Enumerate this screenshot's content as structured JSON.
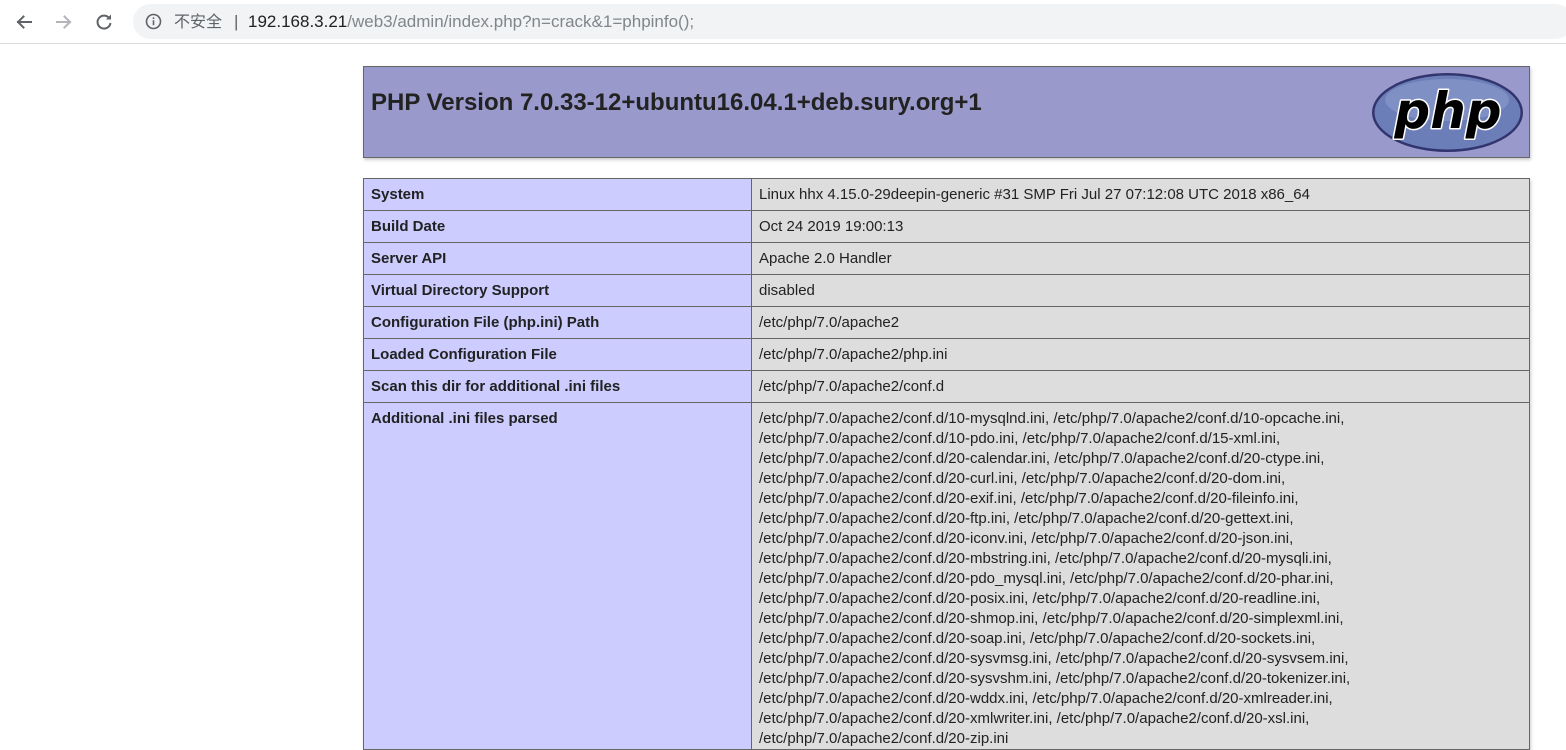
{
  "browser": {
    "security_label": "不安全",
    "separator": "|",
    "url_host": "192.168.3.21",
    "url_path": "/web3/admin/index.php?n=crack&1=phpinfo();",
    "icons": {
      "back": "arrow-left-icon",
      "forward": "arrow-right-icon",
      "reload": "reload-icon",
      "info": "info-circle-icon"
    }
  },
  "header": {
    "title": "PHP Version 7.0.33-12+ubuntu16.04.1+deb.sury.org+1",
    "logo_text": "php"
  },
  "colors": {
    "header_bg": "#9999cc",
    "key_bg": "#ccccff",
    "value_bg": "#dddddd",
    "logo_fill": "#6c7eb7"
  },
  "table": {
    "rows": [
      {
        "key": "System",
        "value": "Linux hhx 4.15.0-29deepin-generic #31 SMP Fri Jul 27 07:12:08 UTC 2018 x86_64"
      },
      {
        "key": "Build Date",
        "value": "Oct 24 2019 19:00:13"
      },
      {
        "key": "Server API",
        "value": "Apache 2.0 Handler"
      },
      {
        "key": "Virtual Directory Support",
        "value": "disabled"
      },
      {
        "key": "Configuration File (php.ini) Path",
        "value": "/etc/php/7.0/apache2"
      },
      {
        "key": "Loaded Configuration File",
        "value": "/etc/php/7.0/apache2/php.ini"
      },
      {
        "key": "Scan this dir for additional .ini files",
        "value": "/etc/php/7.0/apache2/conf.d"
      }
    ],
    "ini_files": {
      "key": "Additional .ini files parsed",
      "lines": [
        "/etc/php/7.0/apache2/conf.d/10-mysqlnd.ini, /etc/php/7.0/apache2/conf.d/10-opcache.ini,",
        "/etc/php/7.0/apache2/conf.d/10-pdo.ini, /etc/php/7.0/apache2/conf.d/15-xml.ini,",
        "/etc/php/7.0/apache2/conf.d/20-calendar.ini, /etc/php/7.0/apache2/conf.d/20-ctype.ini,",
        "/etc/php/7.0/apache2/conf.d/20-curl.ini, /etc/php/7.0/apache2/conf.d/20-dom.ini,",
        "/etc/php/7.0/apache2/conf.d/20-exif.ini, /etc/php/7.0/apache2/conf.d/20-fileinfo.ini,",
        "/etc/php/7.0/apache2/conf.d/20-ftp.ini, /etc/php/7.0/apache2/conf.d/20-gettext.ini,",
        "/etc/php/7.0/apache2/conf.d/20-iconv.ini, /etc/php/7.0/apache2/conf.d/20-json.ini,",
        "/etc/php/7.0/apache2/conf.d/20-mbstring.ini, /etc/php/7.0/apache2/conf.d/20-mysqli.ini,",
        "/etc/php/7.0/apache2/conf.d/20-pdo_mysql.ini, /etc/php/7.0/apache2/conf.d/20-phar.ini,",
        "/etc/php/7.0/apache2/conf.d/20-posix.ini, /etc/php/7.0/apache2/conf.d/20-readline.ini,",
        "/etc/php/7.0/apache2/conf.d/20-shmop.ini, /etc/php/7.0/apache2/conf.d/20-simplexml.ini,",
        "/etc/php/7.0/apache2/conf.d/20-soap.ini, /etc/php/7.0/apache2/conf.d/20-sockets.ini,",
        "/etc/php/7.0/apache2/conf.d/20-sysvmsg.ini, /etc/php/7.0/apache2/conf.d/20-sysvsem.ini,",
        "/etc/php/7.0/apache2/conf.d/20-sysvshm.ini, /etc/php/7.0/apache2/conf.d/20-tokenizer.ini,",
        "/etc/php/7.0/apache2/conf.d/20-wddx.ini, /etc/php/7.0/apache2/conf.d/20-xmlreader.ini,",
        "/etc/php/7.0/apache2/conf.d/20-xmlwriter.ini, /etc/php/7.0/apache2/conf.d/20-xsl.ini,",
        "/etc/php/7.0/apache2/conf.d/20-zip.ini"
      ]
    }
  }
}
